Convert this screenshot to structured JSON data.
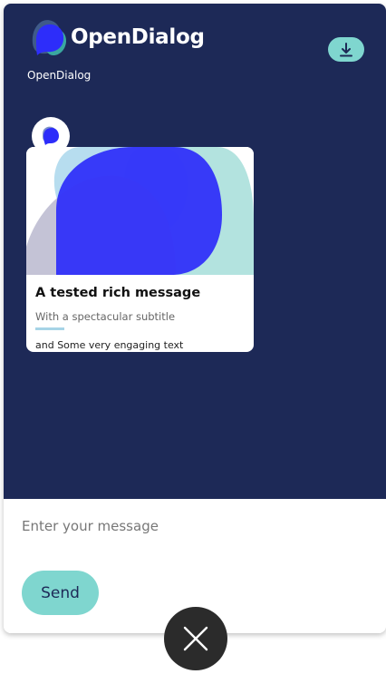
{
  "header": {
    "brand_name": "OpenDialog",
    "subtitle": "OpenDialog",
    "download_icon": "download-icon"
  },
  "message": {
    "title": "A tested rich message",
    "subtitle": "With a spectacular subtitle",
    "text": "and Some very engaging text"
  },
  "composer": {
    "placeholder": "Enter your message",
    "value": "",
    "send_label": "Send"
  },
  "launcher": {
    "close_icon": "close-icon"
  },
  "colors": {
    "chat_background": "#1d2957",
    "accent": "#7fd6cf",
    "brand_blue": "#2d2dfa",
    "close_button": "#2b2b2b"
  }
}
